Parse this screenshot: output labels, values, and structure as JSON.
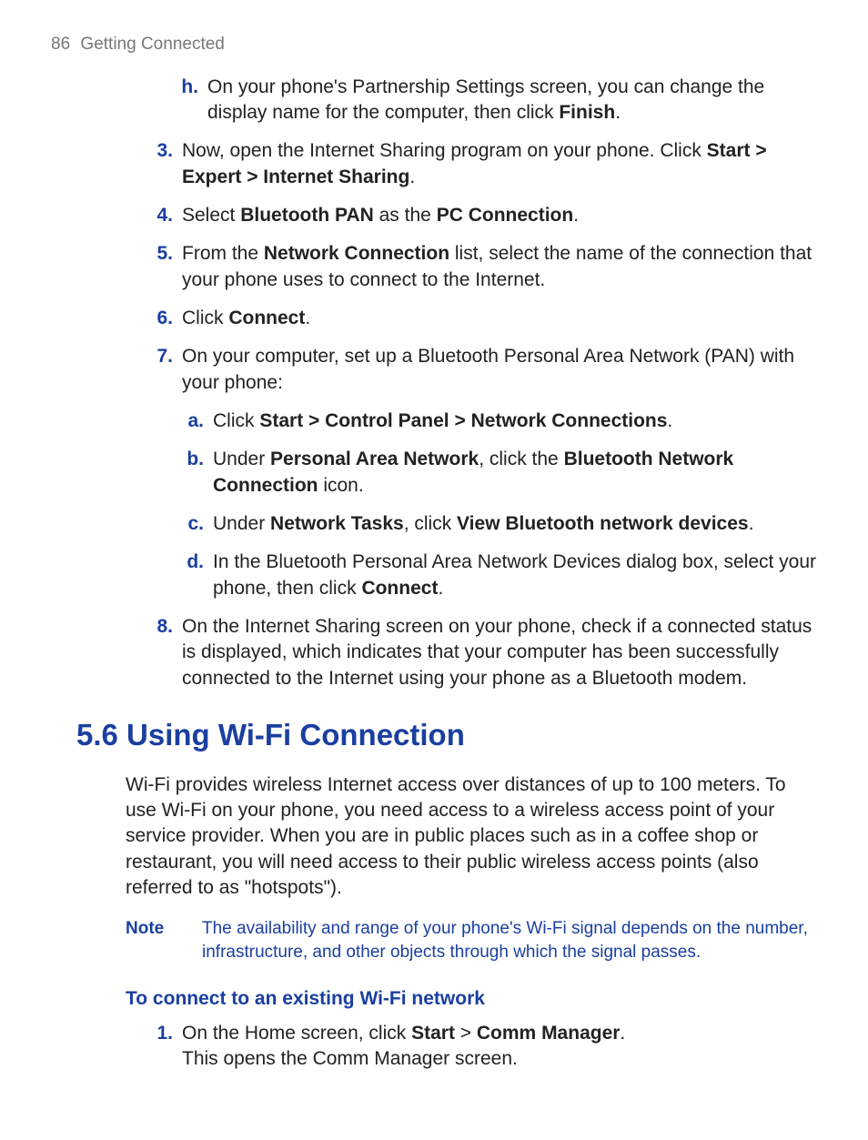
{
  "header": {
    "page": "86",
    "title": "Getting Connected"
  },
  "items": {
    "h": {
      "marker": "h.",
      "pre": "On your phone's Partnership Settings screen, you can change the display name for the computer, then click ",
      "b1": "Finish",
      "post": "."
    },
    "n3": {
      "marker": "3.",
      "pre": "Now, open the Internet Sharing program on your phone. Click ",
      "b1": "Start > Expert > Internet Sharing",
      "post": "."
    },
    "n4": {
      "marker": "4.",
      "pre": "Select ",
      "b1": "Bluetooth PAN",
      "mid": " as the ",
      "b2": "PC Connection",
      "post": "."
    },
    "n5": {
      "marker": "5.",
      "pre": "From the ",
      "b1": "Network Connection",
      "post": " list, select the name of the connection that your phone uses to connect to the Internet."
    },
    "n6": {
      "marker": "6.",
      "pre": "Click ",
      "b1": "Connect",
      "post": "."
    },
    "n7": {
      "marker": "7.",
      "text": "On your computer, set up a Bluetooth Personal Area Network (PAN) with your phone:"
    },
    "a": {
      "marker": "a.",
      "pre": "Click ",
      "b1": "Start > Control Panel > Network Connections",
      "post": "."
    },
    "b": {
      "marker": "b.",
      "pre": "Under ",
      "b1": "Personal Area Network",
      "mid": ", click the ",
      "b2": "Bluetooth Network Connection",
      "post": " icon."
    },
    "c": {
      "marker": "c.",
      "pre": "Under ",
      "b1": "Network Tasks",
      "mid": ", click ",
      "b2": "View Bluetooth network devices",
      "post": "."
    },
    "d": {
      "marker": "d.",
      "pre": "In the Bluetooth Personal Area Network Devices dialog box, select your phone, then click ",
      "b1": "Connect",
      "post": "."
    },
    "n8": {
      "marker": "8.",
      "text": "On the Internet Sharing screen on your phone, check if a connected status is displayed, which indicates that your computer has been successfully connected to the Internet using your phone as a Bluetooth modem."
    }
  },
  "section": {
    "heading": "5.6 Using Wi-Fi Connection"
  },
  "para": "Wi-Fi provides wireless Internet access over distances of up to 100 meters. To use Wi-Fi on your phone, you need access to a wireless access point of your service provider. When you are in public places such as in a coffee shop or restaurant, you will need access to their public wireless access points (also referred to as \"hotspots\").",
  "note": {
    "label": "Note",
    "text": "The availability and range of your phone's Wi-Fi signal depends on the number, infrastructure, and other objects through which the signal passes."
  },
  "sub": {
    "heading": "To connect to an existing Wi-Fi network"
  },
  "step1": {
    "marker": "1.",
    "pre": "On the Home screen, click ",
    "b1": "Start",
    "mid": " > ",
    "b2": "Comm Manager",
    "post1": ".",
    "line2": "This opens the Comm Manager screen."
  }
}
